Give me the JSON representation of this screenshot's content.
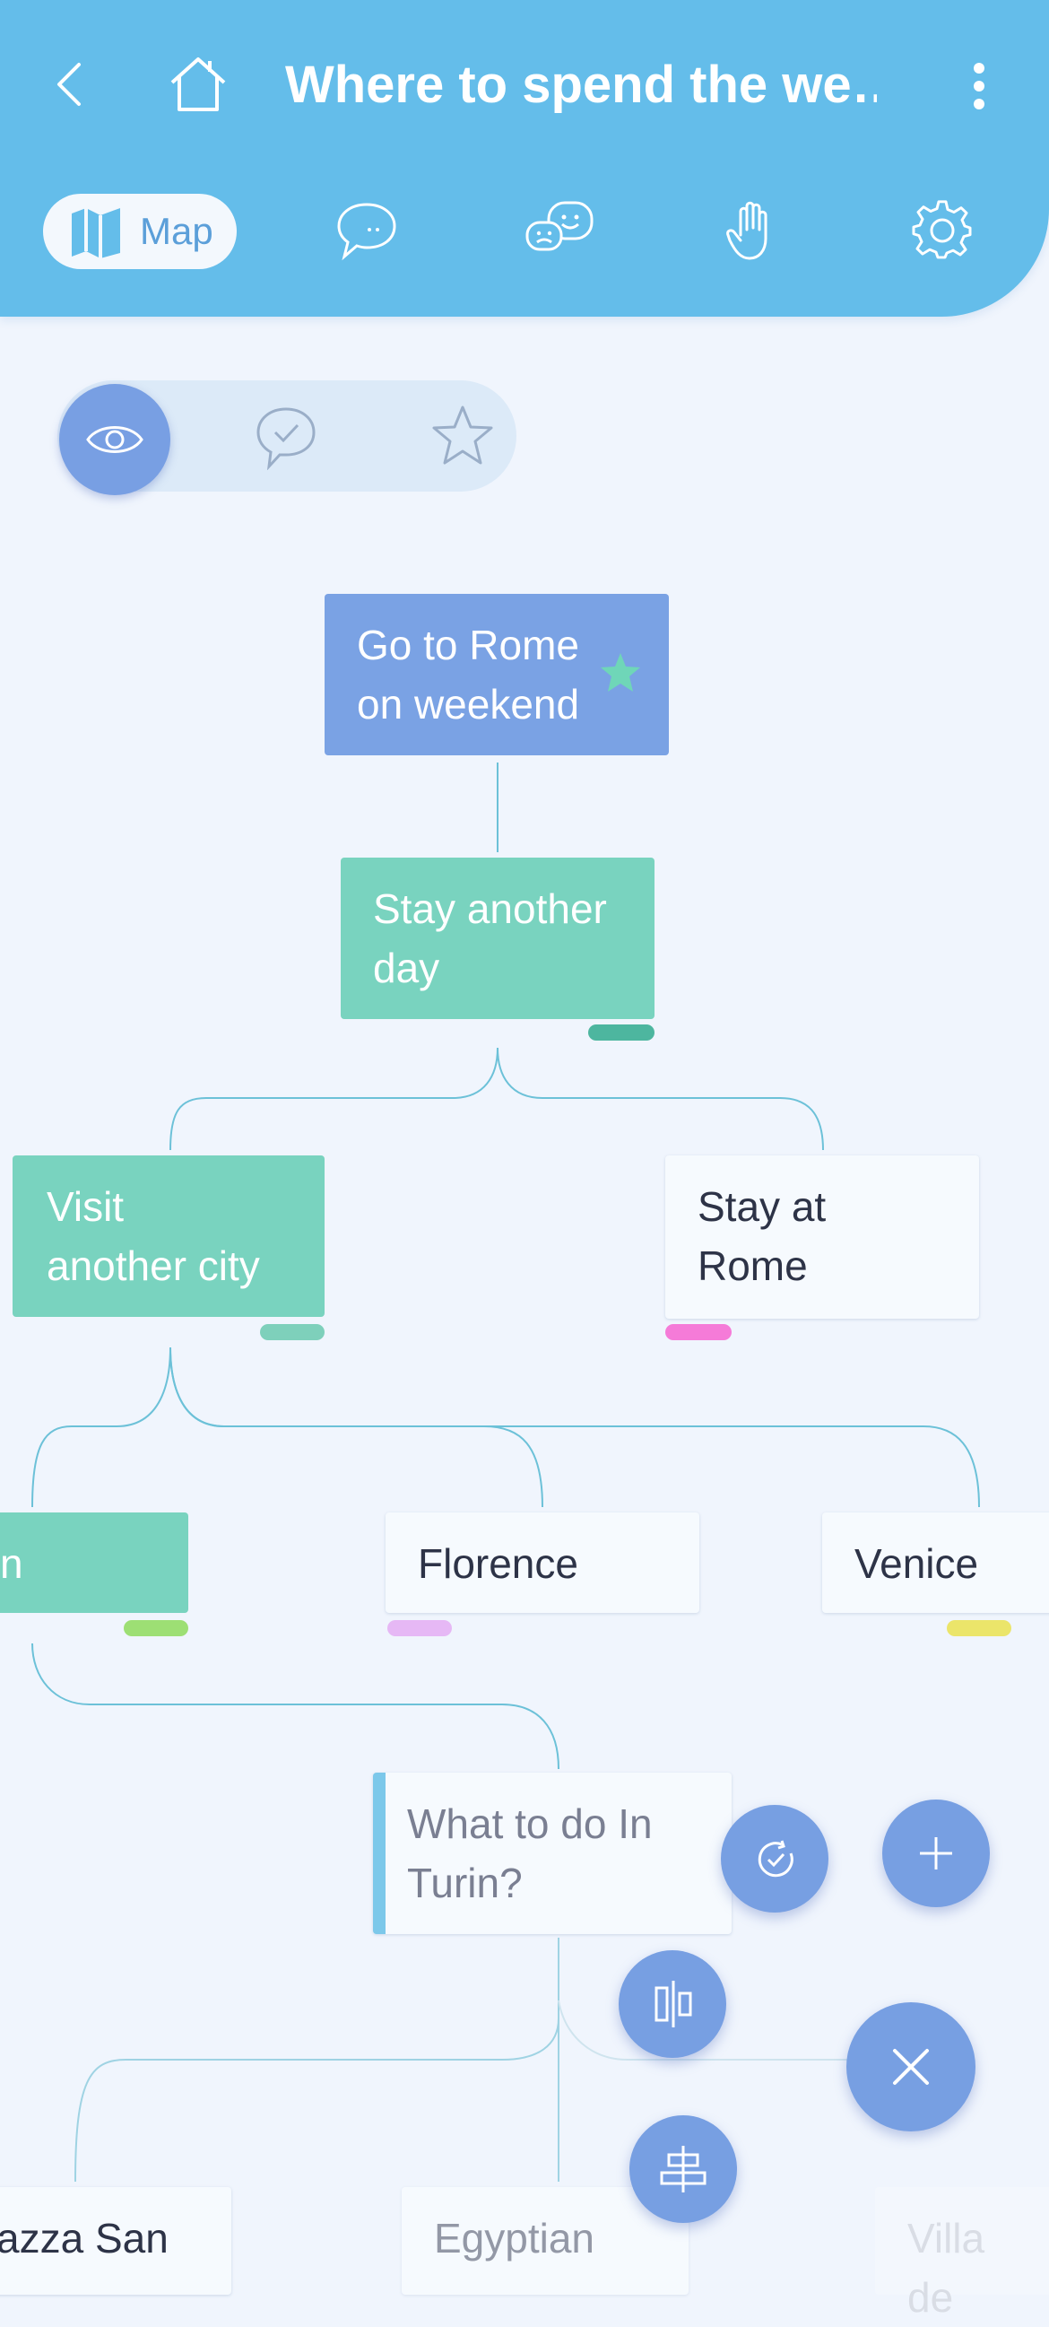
{
  "header": {
    "title": "Where to spend the we…",
    "back_icon": "chevron-left-icon",
    "home_icon": "home-icon",
    "menu_icon": "more-vertical-icon",
    "tabs": [
      {
        "label": "Map",
        "icon": "map-icon",
        "active": true
      },
      {
        "label": "",
        "icon": "chat-icon"
      },
      {
        "label": "",
        "icon": "emoji-chat-icon"
      },
      {
        "label": "",
        "icon": "hand-icon"
      },
      {
        "label": "",
        "icon": "settings-icon"
      }
    ]
  },
  "filters": [
    {
      "icon": "eye-icon",
      "active": true
    },
    {
      "icon": "comment-check-icon",
      "active": false
    },
    {
      "icon": "star-icon",
      "active": false
    }
  ],
  "nodes": {
    "root": {
      "text": "Go to Rome on weekend",
      "line1": "Go to Rome",
      "line2": "on weekend",
      "starred": true
    },
    "stay_day": {
      "line1": "Stay another",
      "line2": "day"
    },
    "visit_city": {
      "line1": "Visit",
      "line2": "another city"
    },
    "stay_rome": {
      "line1": "Stay at",
      "line2": "Rome"
    },
    "turin_partial": {
      "text": "n"
    },
    "florence": {
      "text": "Florence"
    },
    "venice": {
      "text": "Venice"
    },
    "question": {
      "line1": "What to do In",
      "line2": "Turin?"
    },
    "piazza": {
      "text": "azza San"
    },
    "egyptian": {
      "text": "Egyptian"
    },
    "villa": {
      "text": "Villa de"
    }
  },
  "colors": {
    "header": "#64bdea",
    "root_node": "#7aa2e4",
    "pro_node": "#79d3bf",
    "tag_dark_green": "#4db69f",
    "tag_green": "#7ed0bb",
    "tag_pink": "#f57bd8",
    "tag_lime": "#9ddf74",
    "tag_violet": "#e6b8f5",
    "tag_yellow": "#ebe56a",
    "fab": "#779fe2"
  },
  "fabs": [
    {
      "icon": "timer-check-icon"
    },
    {
      "icon": "plus-icon"
    },
    {
      "icon": "align-vertical-icon"
    },
    {
      "icon": "close-icon"
    },
    {
      "icon": "align-horizontal-icon"
    }
  ]
}
